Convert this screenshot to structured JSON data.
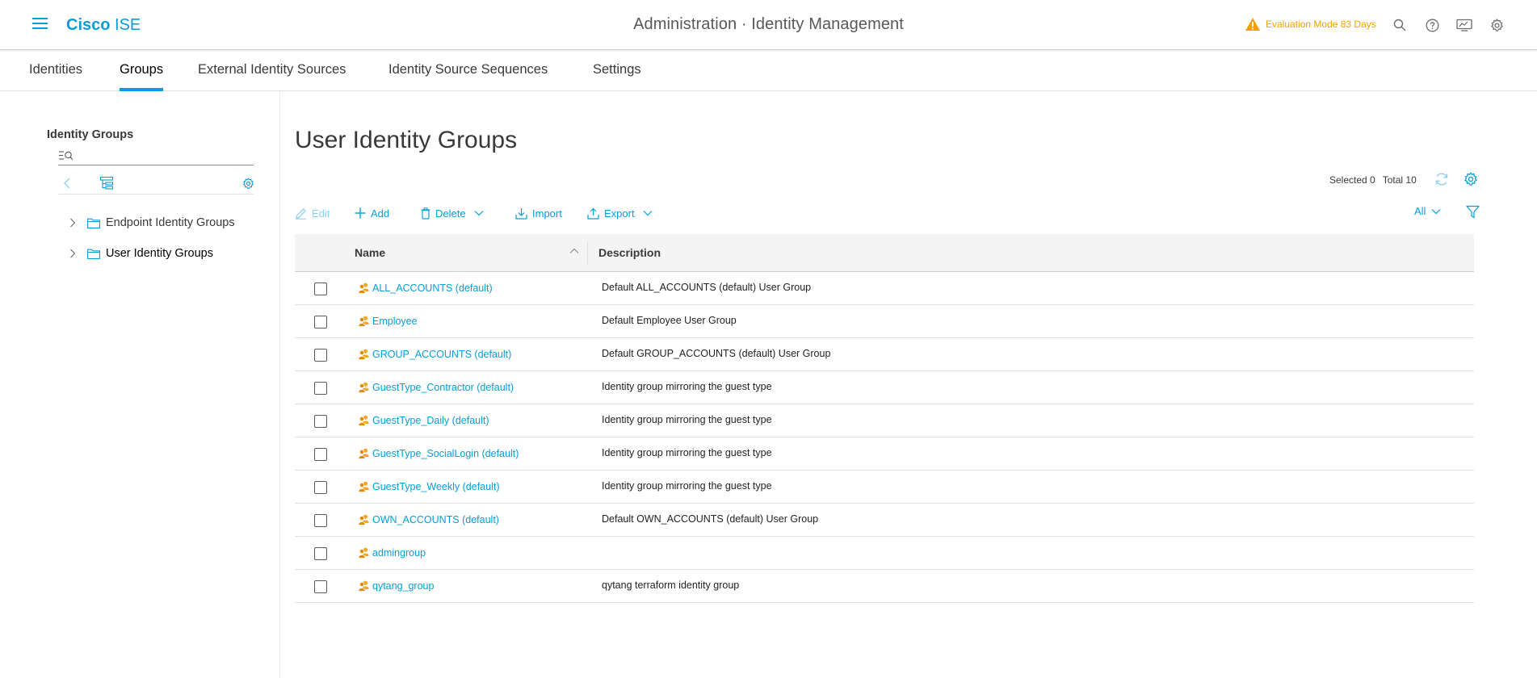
{
  "header": {
    "brand_bold": "Cisco",
    "brand_light": "ISE",
    "title": "Administration · Identity Management",
    "evaluation": "Evaluation Mode 83 Days",
    "accent_color": "#049fd9",
    "warning_color": "#f2a100"
  },
  "tabs": [
    {
      "label": "Identities"
    },
    {
      "label": "Groups",
      "active": true
    },
    {
      "label": "External Identity Sources"
    },
    {
      "label": "Identity Source Sequences"
    },
    {
      "label": "Settings"
    }
  ],
  "sidebar": {
    "title": "Identity Groups",
    "search_placeholder": "",
    "tree": [
      {
        "label": "Endpoint Identity Groups"
      },
      {
        "label": "User Identity Groups",
        "selected": true
      }
    ]
  },
  "main": {
    "title": "User Identity Groups",
    "selected_label": "Selected 0",
    "total_label": "Total 10",
    "toolbar": {
      "edit": "Edit",
      "add": "Add",
      "delete": "Delete",
      "import": "Import",
      "export": "Export",
      "filter_value": "All"
    },
    "table": {
      "columns": [
        "Name",
        "Description"
      ],
      "rows": [
        {
          "name": "ALL_ACCOUNTS (default)",
          "description": "Default ALL_ACCOUNTS (default) User Group"
        },
        {
          "name": "Employee",
          "description": "Default Employee User Group"
        },
        {
          "name": "GROUP_ACCOUNTS (default)",
          "description": "Default GROUP_ACCOUNTS (default) User Group"
        },
        {
          "name": "GuestType_Contractor (default)",
          "description": "Identity group mirroring the guest type"
        },
        {
          "name": "GuestType_Daily (default)",
          "description": "Identity group mirroring the guest type"
        },
        {
          "name": "GuestType_SocialLogin (default)",
          "description": "Identity group mirroring the guest type"
        },
        {
          "name": "GuestType_Weekly (default)",
          "description": "Identity group mirroring the guest type"
        },
        {
          "name": "OWN_ACCOUNTS (default)",
          "description": "Default OWN_ACCOUNTS (default) User Group"
        },
        {
          "name": "admingroup",
          "description": ""
        },
        {
          "name": "qytang_group",
          "description": "qytang terraform identity group"
        }
      ]
    }
  }
}
